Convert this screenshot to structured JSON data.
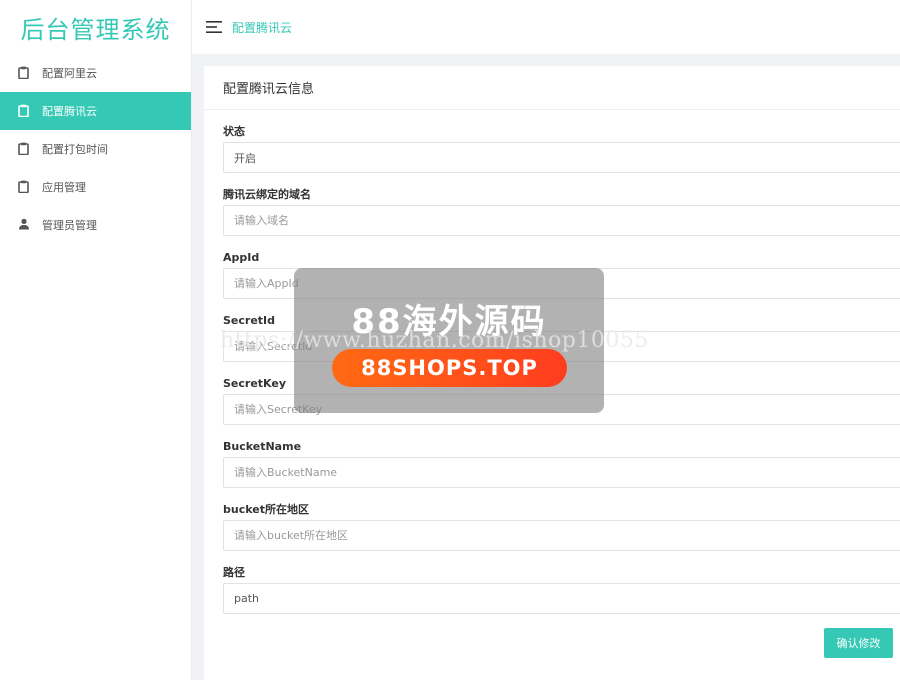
{
  "app": {
    "logo": "后台管理系统"
  },
  "sidebar": {
    "items": [
      {
        "label": "配置阿里云",
        "icon": "clipboard-icon",
        "active": false
      },
      {
        "label": "配置腾讯云",
        "icon": "clipboard-icon",
        "active": true
      },
      {
        "label": "配置打包时间",
        "icon": "clipboard-icon",
        "active": false
      },
      {
        "label": "应用管理",
        "icon": "clipboard-icon",
        "active": false
      },
      {
        "label": "管理员管理",
        "icon": "user-icon",
        "active": false
      }
    ]
  },
  "header": {
    "title": "配置腾讯云",
    "menu_icon": "hamburger-icon"
  },
  "card": {
    "title": "配置腾讯云信息",
    "fields": [
      {
        "label": "状态",
        "value": "开启",
        "placeholder": ""
      },
      {
        "label": "腾讯云绑定的域名",
        "value": "",
        "placeholder": "请输入域名"
      },
      {
        "label": "AppId",
        "value": "",
        "placeholder": "请输入AppId"
      },
      {
        "label": "SecretId",
        "value": "",
        "placeholder": "请输入SecretId"
      },
      {
        "label": "SecretKey",
        "value": "",
        "placeholder": "请输入SecretKey"
      },
      {
        "label": "BucketName",
        "value": "",
        "placeholder": "请输入BucketName"
      },
      {
        "label": "bucket所在地区",
        "value": "",
        "placeholder": "请输入bucket所在地区"
      },
      {
        "label": "路径",
        "value": "path",
        "placeholder": ""
      }
    ],
    "submit_label": "确认修改"
  },
  "watermark": {
    "title": "88海外源码",
    "url": "https://www.huzhan.com/ishop10055",
    "badge": "88SHOPS.TOP"
  },
  "colors": {
    "accent": "#35c8b5",
    "badge": "#ff5a1a"
  }
}
